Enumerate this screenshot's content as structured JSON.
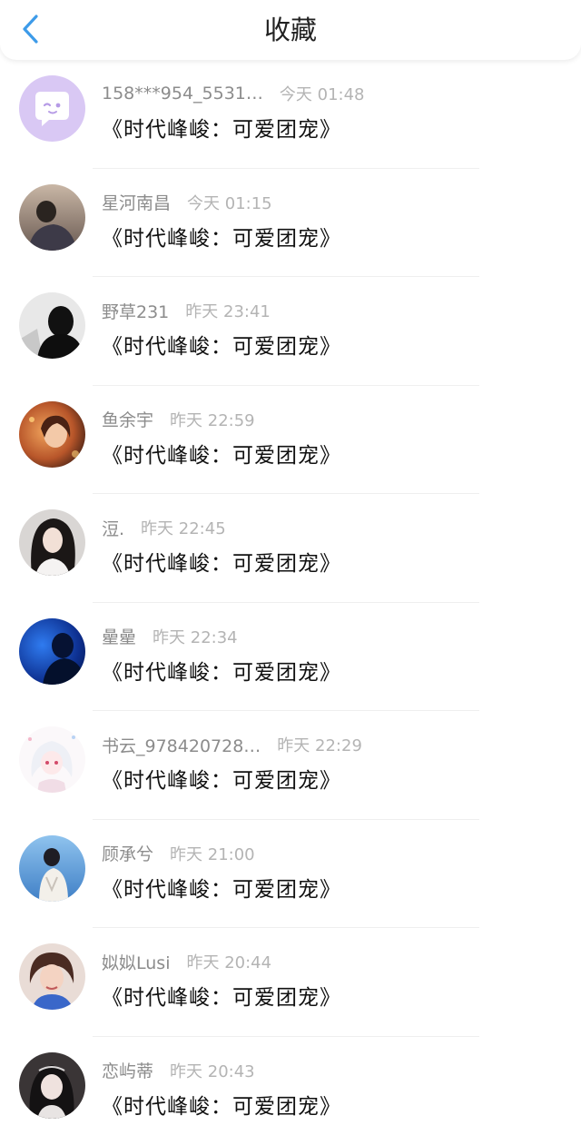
{
  "header": {
    "title": "收藏",
    "back_icon": "chevron-left-icon",
    "accent_color": "#3d9be9"
  },
  "items": [
    {
      "nickname": "158***954_5531…",
      "time": "今天 01:48",
      "book": "《时代峰峻：可爱团宠》",
      "avatar": "default-chat-avatar"
    },
    {
      "nickname": "星河南昌",
      "time": "今天 01:15",
      "book": "《时代峰峻：可爱团宠》",
      "avatar": "user-photo"
    },
    {
      "nickname": "野草231",
      "time": "昨天 23:41",
      "book": "《时代峰峻：可爱团宠》",
      "avatar": "user-photo"
    },
    {
      "nickname": "鱼余宇",
      "time": "昨天 22:59",
      "book": "《时代峰峻：可爱团宠》",
      "avatar": "user-photo"
    },
    {
      "nickname": "浢.",
      "time": "昨天 22:45",
      "book": "《时代峰峻：可爱团宠》",
      "avatar": "user-photo"
    },
    {
      "nickname": "曐曐",
      "time": "昨天 22:34",
      "book": "《时代峰峻：可爱团宠》",
      "avatar": "user-photo"
    },
    {
      "nickname": "书云_978420728…",
      "time": "昨天 22:29",
      "book": "《时代峰峻：可爱团宠》",
      "avatar": "user-illustration"
    },
    {
      "nickname": "顾承兮",
      "time": "昨天 21:00",
      "book": "《时代峰峻：可爱团宠》",
      "avatar": "user-photo"
    },
    {
      "nickname": "姒姒Lusi",
      "time": "昨天 20:44",
      "book": "《时代峰峻：可爱团宠》",
      "avatar": "user-photo"
    },
    {
      "nickname": "恋屿蒂",
      "time": "昨天 20:43",
      "book": "《时代峰峻：可爱团宠》",
      "avatar": "user-photo"
    }
  ]
}
